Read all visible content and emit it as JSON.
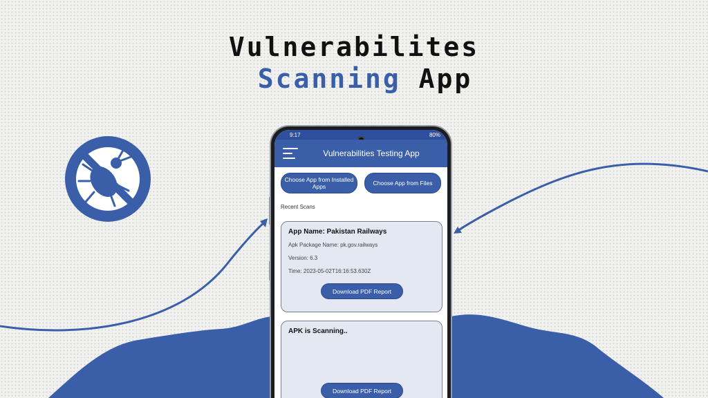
{
  "headline": {
    "line1": "Vulnerabilites",
    "line2_accent": "Scanning",
    "line2_rest": "App"
  },
  "colors": {
    "accent": "#3a5ea8",
    "dark": "#111111",
    "background": "#f1f1ef"
  },
  "decor": {
    "icon": "no-bug-icon"
  },
  "phone": {
    "status": {
      "time": "9:17",
      "battery": "80%"
    },
    "app_title": "Vulnerabilities Testing App",
    "buttons": {
      "installed": "Choose App from Installed Apps",
      "files": "Choose App from Files"
    },
    "recent_label": "Recent Scans",
    "scans": [
      {
        "title": "App Name: Pakistan Railways",
        "package": "Apk Package Name: pk.gov.railways",
        "version": "Version: 6.3",
        "time": "Time: 2023-05-02T16:16:53.630Z",
        "button": "Download PDF Report"
      },
      {
        "title": "APK is Scanning..",
        "button": "Download PDF Report"
      }
    ]
  }
}
